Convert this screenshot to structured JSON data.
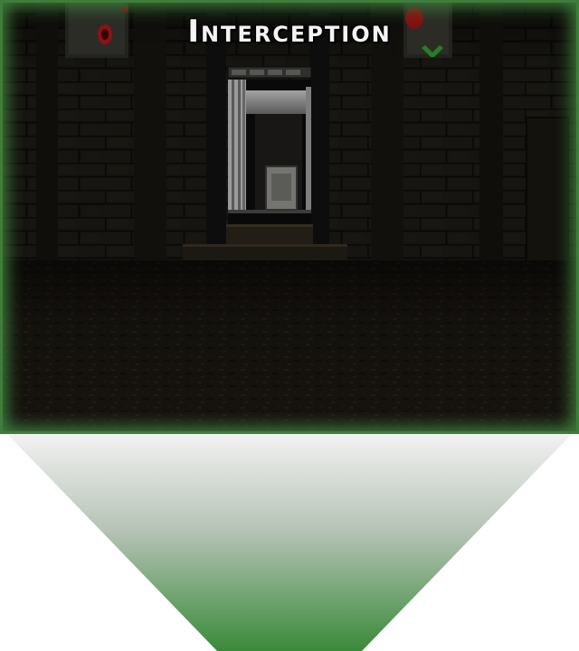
{
  "level": {
    "title": "Interception"
  },
  "colors": {
    "frame_glow": "#3f7d3c",
    "funnel_top": "#f2f2f2",
    "funnel_bottom": "#3a8a3a",
    "wall": "#1c1a15",
    "floor": "#1e1a14",
    "sky": "#9a9a9a",
    "gargoyle_red": "#b01515",
    "gargoyle_green": "#2f9a2f"
  },
  "icons": {
    "left_ornament": "red-gargoyle-icon",
    "right_ornament": "green-gargoyle-icon"
  }
}
